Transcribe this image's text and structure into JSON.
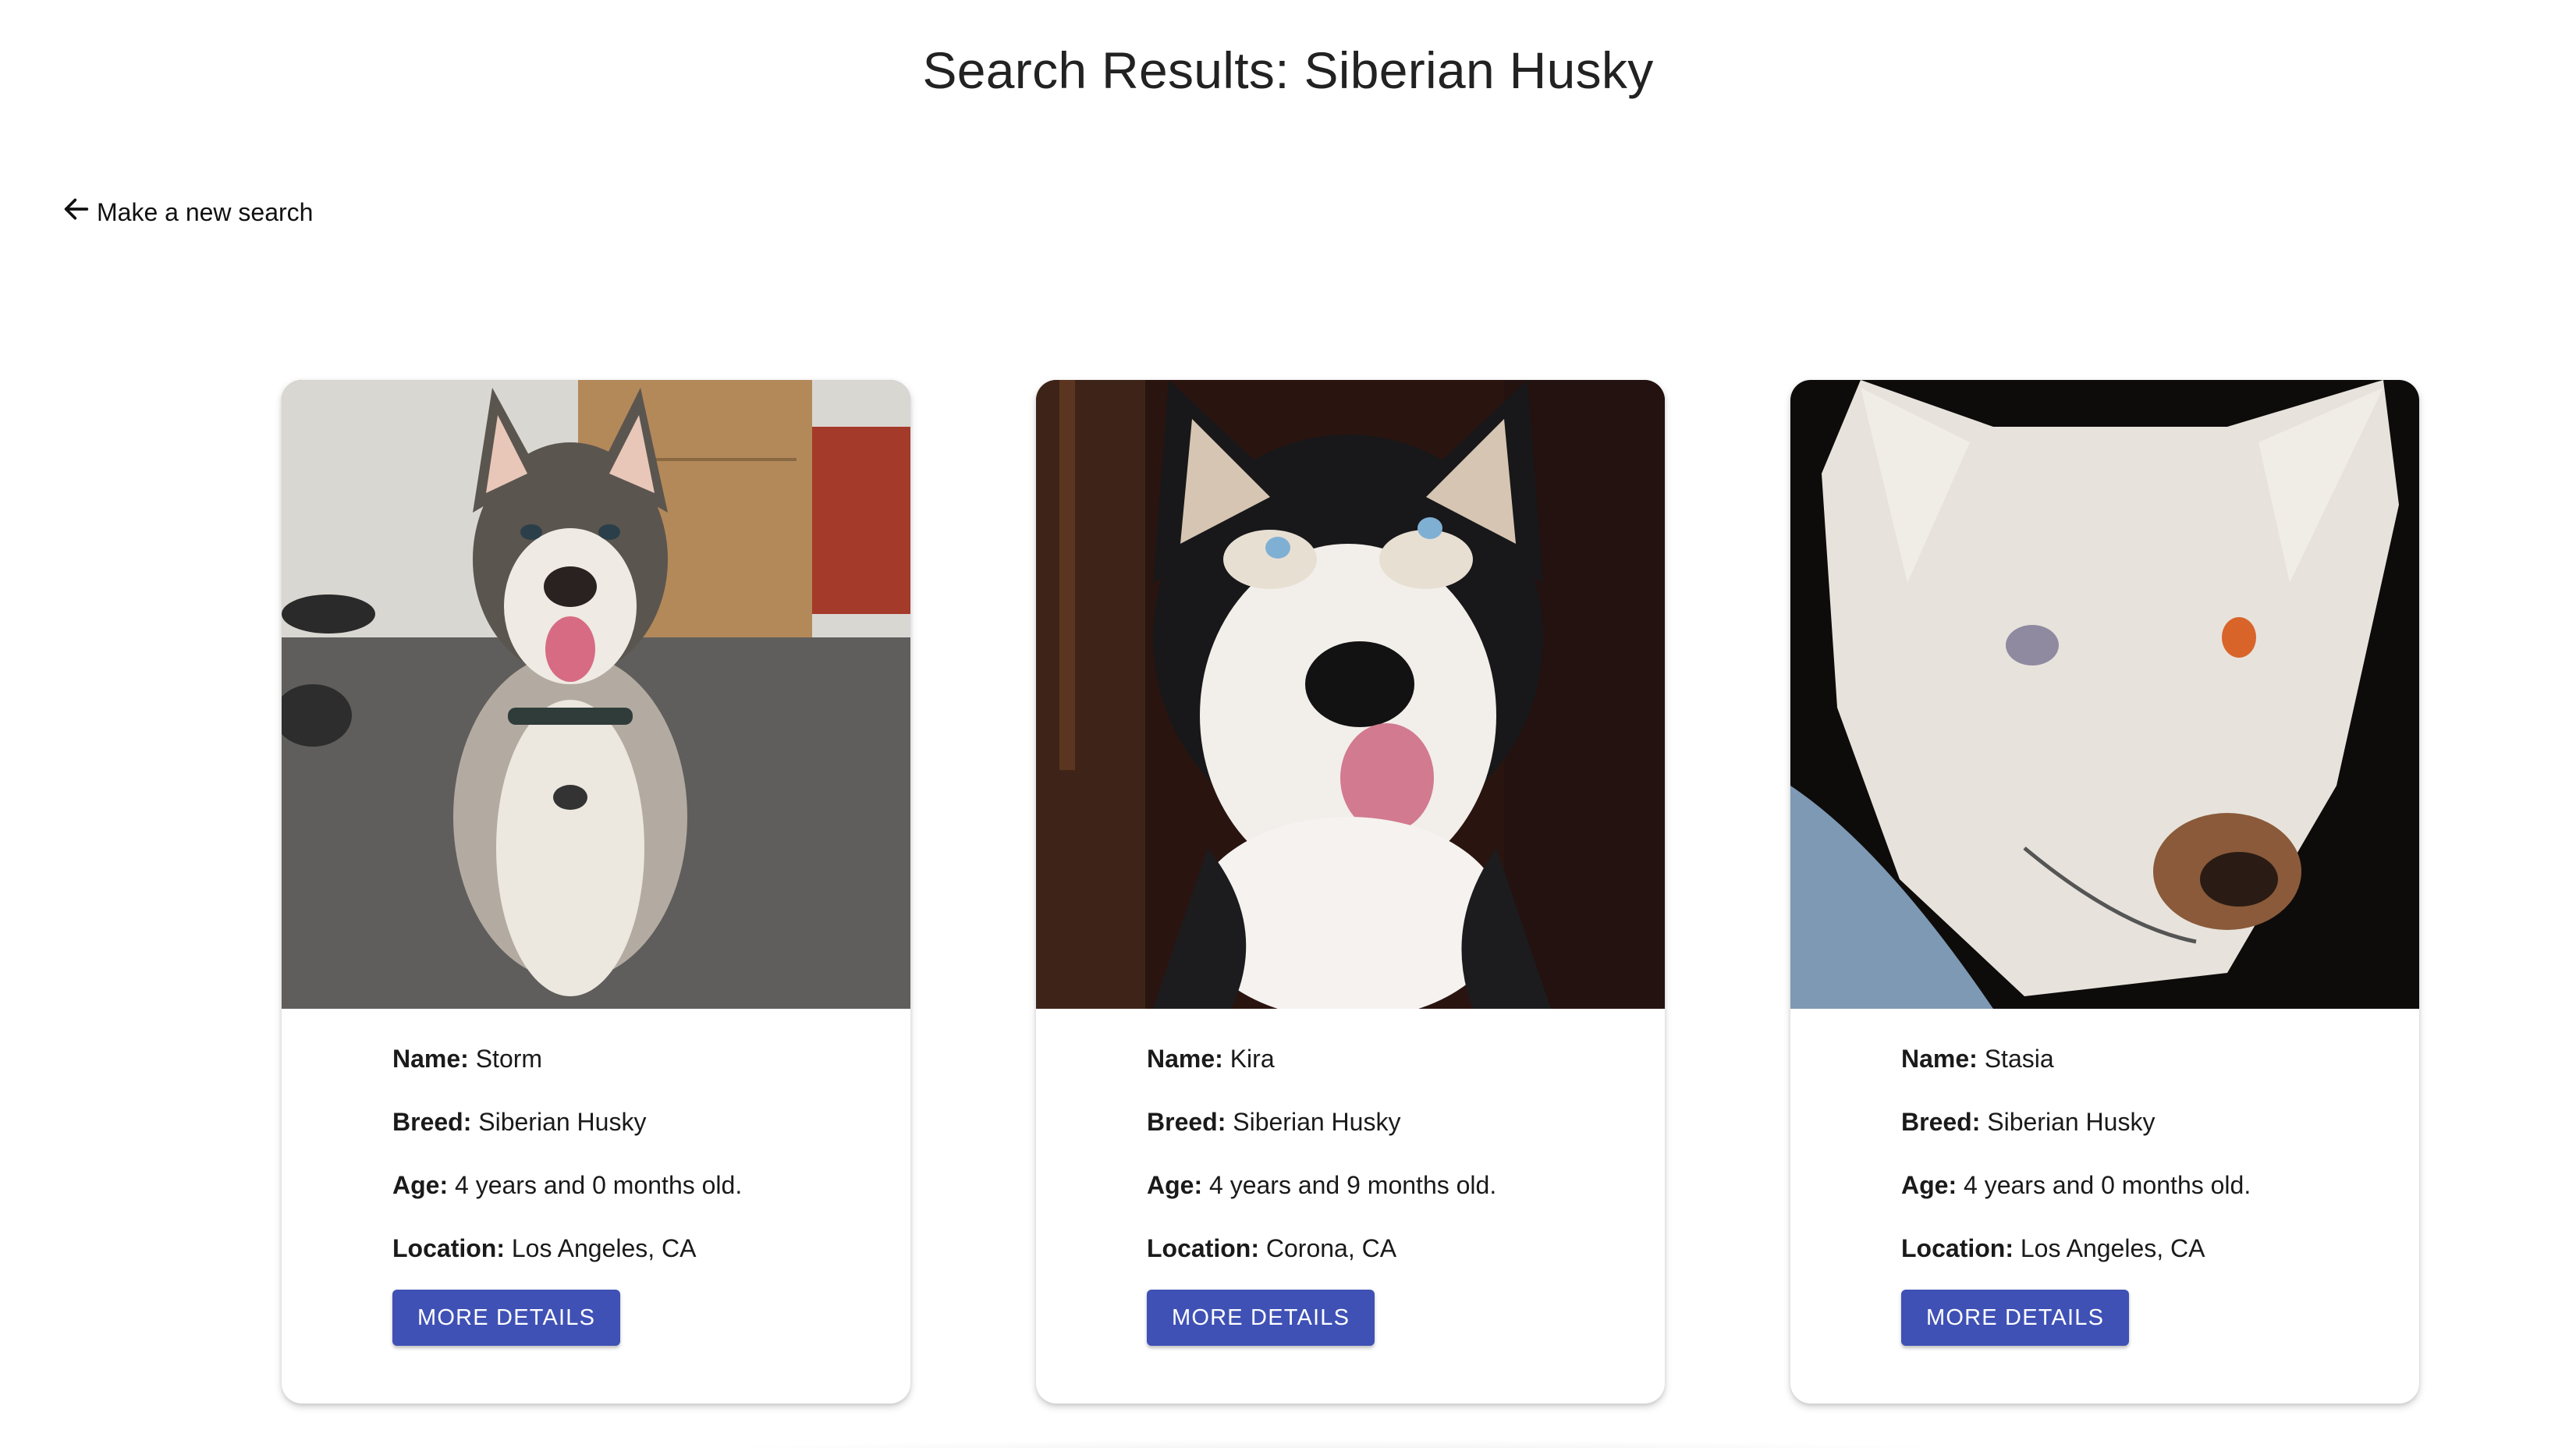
{
  "header": {
    "title": "Search Results: Siberian Husky"
  },
  "back_link": {
    "icon": "arrow-left-icon",
    "label": "Make a new search"
  },
  "labels": {
    "name": "Name:",
    "breed": "Breed:",
    "age": "Age:",
    "location": "Location:"
  },
  "results": [
    {
      "photo_icon": "husky-photo",
      "name": "Storm",
      "breed": "Siberian Husky",
      "age": "4 years and 0 months old.",
      "location": "Los Angeles, CA",
      "button": "MORE DETAILS"
    },
    {
      "photo_icon": "husky-photo",
      "name": "Kira",
      "breed": "Siberian Husky",
      "age": "4 years and 9 months old.",
      "location": "Corona, CA",
      "button": "MORE DETAILS"
    },
    {
      "photo_icon": "husky-photo",
      "name": "Stasia",
      "breed": "Siberian Husky",
      "age": "4 years and 0 months old.",
      "location": "Los Angeles, CA",
      "button": "MORE DETAILS"
    }
  ],
  "colors": {
    "button_bg": "#3f51b5",
    "button_text": "#ffffff",
    "page_bg": "#ffffff"
  }
}
